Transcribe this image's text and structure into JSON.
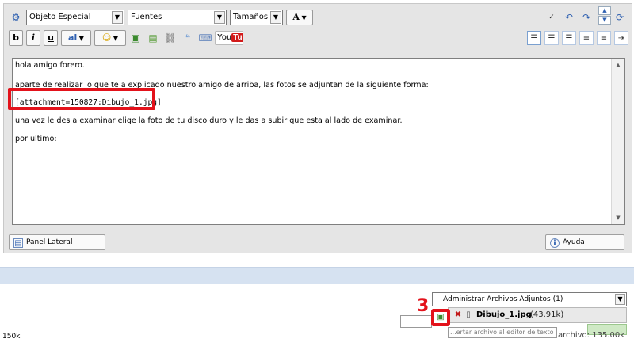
{
  "toolbar": {
    "special_object": "Objeto Especial",
    "fonts": "Fuentes",
    "sizes": "Tamaños",
    "font_color_letter": "A",
    "bold": "b",
    "italic": "i",
    "underline": "u",
    "format_letters": "al",
    "youtube_you": "You",
    "youtube_tube": "Tube"
  },
  "editor": {
    "lines": [
      "hola amigo forero.",
      "aparte de realizar lo que te a explicado nuestro amigo de arriba, las fotos se adjuntan de la siguiente forma:",
      "[attachment=150827:Dibujo_1.jpg]",
      "una vez le des a examinar elige la foto de tu disco duro y le das a subir que esta al lado de examinar.",
      "por ultimo:"
    ]
  },
  "buttons": {
    "side_panel": "Panel Lateral",
    "help": "Ayuda"
  },
  "attachments": {
    "manage_label": "Administrar Archivos Adjuntos (1)",
    "file_name": "Dibujo_1.jpg",
    "file_size": "(43.91k)",
    "tooltip": "...ertar archivo al editor de texto"
  },
  "annotation": {
    "step_number": "3"
  },
  "footer": {
    "left_text": "150k",
    "right_text": "archivo: 135.00k"
  },
  "colors": {
    "annotation_red": "#e3121b",
    "icon_blue": "#2d5fb0",
    "band_blue": "#d6e2f1"
  }
}
